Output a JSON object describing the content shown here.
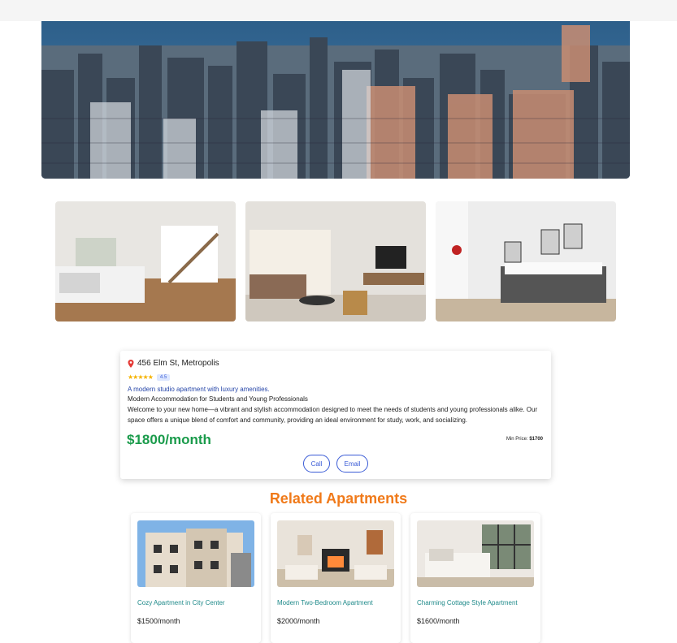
{
  "hero": {
    "image": "city-skyline-photo"
  },
  "gallery": [
    {
      "image": "bedroom-loft-photo"
    },
    {
      "image": "living-room-photo"
    },
    {
      "image": "modern-bedroom-photo"
    }
  ],
  "listing": {
    "address": "456 Elm St, Metropolis",
    "stars": "★★★★★",
    "rating": "4.5",
    "tagline": "A modern studio apartment with luxury amenities.",
    "subtitle": "Modern Accommodation for Students and Young Professionals",
    "description": "Welcome to your new home—a vibrant and stylish accommodation designed to meet the needs of students and young professionals alike. Our space offers a unique blend of comfort and community, providing an ideal environment for study, work, and socializing.",
    "price": "$1800/month",
    "min_price_label": "Min Price:",
    "min_price_value": "$1700",
    "call_label": "Call",
    "email_label": "Email"
  },
  "related": {
    "title": "Related Apartments",
    "items": [
      {
        "name": "Cozy Apartment in City Center",
        "price": "$1500/month",
        "image": "apartment-building-photo"
      },
      {
        "name": "Modern Two-Bedroom Apartment",
        "price": "$2000/month",
        "image": "fireplace-living-room-photo"
      },
      {
        "name": "Charming Cottage Style Apartment",
        "price": "$1600/month",
        "image": "cottage-bedroom-photo"
      }
    ]
  },
  "colors": {
    "accent_blue": "#3a5bd6",
    "price_green": "#1a9b4b",
    "heading_orange": "#f07a1a",
    "link_teal": "#1f8a8a"
  }
}
